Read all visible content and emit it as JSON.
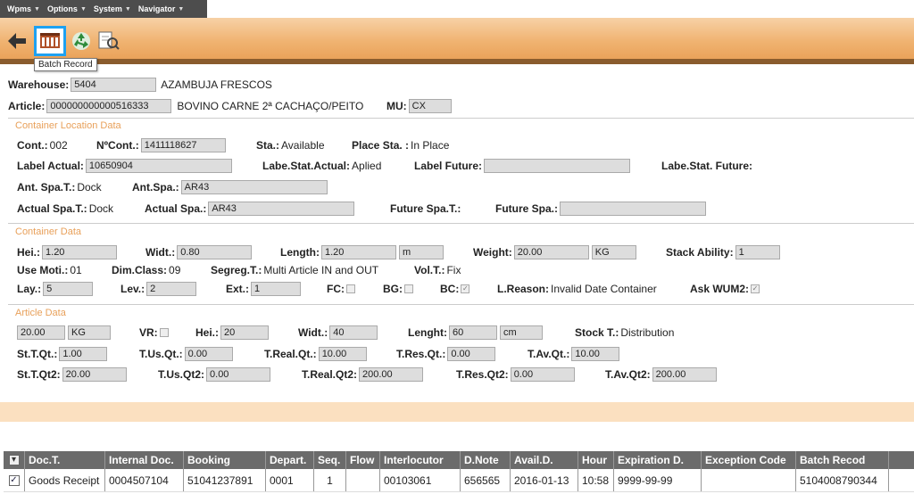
{
  "menu": [
    "Wpms",
    "Options",
    "System",
    "Navigator"
  ],
  "toolbar": {
    "tooltip": "Batch Record"
  },
  "header": {
    "warehouse_label": "Warehouse:",
    "warehouse_value": "5404",
    "warehouse_name": "AZAMBUJA FRESCOS",
    "article_label": "Article:",
    "article_value": "000000000000516333",
    "article_name": "BOVINO CARNE 2ª CACHAÇO/PEITO",
    "mu_label": "MU:",
    "mu_value": "CX"
  },
  "container_location": {
    "title": "Container Location Data",
    "cont_label": "Cont.:",
    "cont_value": "002",
    "ncont_label": "NºCont.:",
    "ncont_value": "1411118627",
    "sta_label": "Sta.:",
    "sta_value": "Available",
    "place_sta_label": "Place Sta. :",
    "place_sta_value": "In Place",
    "label_actual_label": "Label Actual:",
    "label_actual_value": "10650904",
    "labe_stat_actual_label": "Labe.Stat.Actual:",
    "labe_stat_actual_value": "Aplied",
    "label_future_label": "Label Future:",
    "label_future_value": "",
    "labe_stat_future_label": "Labe.Stat. Future:",
    "ant_spa_t_label": "Ant. Spa.T.:",
    "ant_spa_t_value": "Dock",
    "ant_spa_label": "Ant.Spa.:",
    "ant_spa_value": "AR43",
    "actual_spa_t_label": "Actual Spa.T.:",
    "actual_spa_t_value": "Dock",
    "actual_spa_label": "Actual Spa.:",
    "actual_spa_value": "AR43",
    "future_spa_t_label": "Future Spa.T.:",
    "future_spa_label": "Future Spa.:",
    "future_spa_value": ""
  },
  "container": {
    "title": "Container Data",
    "hei_label": "Hei.:",
    "hei_value": "1.20",
    "widt_label": "Widt.:",
    "widt_value": "0.80",
    "length_label": "Length:",
    "length_value": "1.20",
    "length_unit": "m",
    "weight_label": "Weight:",
    "weight_value": "20.00",
    "weight_unit": "KG",
    "stack_label": "Stack Ability:",
    "stack_value": "1",
    "use_moti_label": "Use Moti.:",
    "use_moti_value": "01",
    "dim_class_label": "Dim.Class:",
    "dim_class_value": "09",
    "segreg_label": "Segreg.T.:",
    "segreg_value": "Multi Article IN and OUT",
    "volt_label": "Vol.T.:",
    "volt_value": "Fix",
    "lay_label": "Lay.:",
    "lay_value": "5",
    "lev_label": "Lev.:",
    "lev_value": "2",
    "ext_label": "Ext.:",
    "ext_value": "1",
    "fc_label": "FC:",
    "bg_label": "BG:",
    "bc_label": "BC:",
    "lreason_label": "L.Reason:",
    "lreason_value": "Invalid Date Container",
    "ask_label": "Ask WUM2:"
  },
  "article": {
    "title": "Article Data",
    "qty_value": "20.00",
    "qty_unit": "KG",
    "vr_label": "VR:",
    "hei_label": "Hei.:",
    "hei_value": "20",
    "widt_label": "Widt.:",
    "widt_value": "40",
    "lenght_label": "Lenght:",
    "lenght_value": "60",
    "lenght_unit": "cm",
    "stock_t_label": "Stock T.:",
    "stock_t_value": "Distribution",
    "sttqt_label": "St.T.Qt.:",
    "sttqt_value": "1.00",
    "tusqt_label": "T.Us.Qt.:",
    "tusqt_value": "0.00",
    "trealqt_label": "T.Real.Qt.:",
    "trealqt_value": "10.00",
    "tresqt_label": "T.Res.Qt.:",
    "tresqt_value": "0.00",
    "tavqt_label": "T.Av.Qt.:",
    "tavqt_value": "10.00",
    "sttqt2_label": "St.T.Qt2:",
    "sttqt2_value": "20.00",
    "tusqt2_label": "T.Us.Qt2:",
    "tusqt2_value": "0.00",
    "trealqt2_label": "T.Real.Qt2:",
    "trealqt2_value": "200.00",
    "tresqt2_label": "T.Res.Qt2:",
    "tresqt2_value": "0.00",
    "tavqt2_label": "T.Av.Qt2:",
    "tavqt2_value": "200.00"
  },
  "grid": {
    "columns": [
      "Doc.T.",
      "Internal Doc.",
      "Booking",
      "Depart.",
      "Seq.",
      "Flow",
      "Interlocutor",
      "D.Note",
      "Avail.D.",
      "Hour",
      "Expiration D.",
      "Exception Code",
      "Batch Recod"
    ],
    "rows": [
      [
        "Goods Receipt",
        "0004507104",
        "51041237891",
        "0001",
        "1",
        "",
        "00103061",
        "656565",
        "2016-01-13",
        "10:58",
        "9999-99-99",
        "",
        "5104008790344"
      ]
    ]
  },
  "colors": {
    "accent": "#f0b371",
    "section_title": "#e8a05a",
    "highlight": "#1da1f2"
  }
}
